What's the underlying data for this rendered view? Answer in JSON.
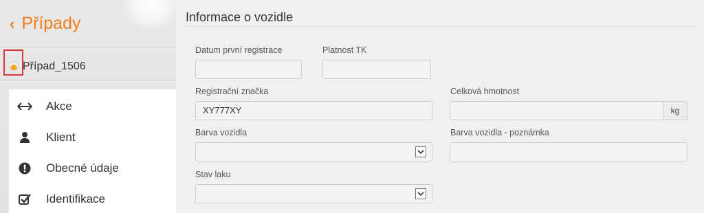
{
  "sidebar": {
    "back_label": "Případy",
    "case_label": "Případ_1506",
    "items": [
      {
        "label": "Akce",
        "icon": "double-arrow-icon"
      },
      {
        "label": "Klient",
        "icon": "user-icon"
      },
      {
        "label": "Obecné údaje",
        "icon": "exclamation-circle-icon"
      },
      {
        "label": "Identifikace",
        "icon": "checkbox-icon"
      }
    ]
  },
  "main": {
    "title": "Informace o vozidle",
    "fields": {
      "first_registration": {
        "label": "Datum první registrace",
        "value": ""
      },
      "tk_valid": {
        "label": "Platnost TK",
        "value": ""
      },
      "plate": {
        "label": "Registrační značka",
        "value": "XY777XY"
      },
      "weight": {
        "label": "Celková hmotnost",
        "value": "",
        "unit": "kg"
      },
      "color": {
        "label": "Barva vozidla",
        "value": ""
      },
      "color_note": {
        "label": "Barva vozidla - poznámka",
        "value": ""
      },
      "paint_state": {
        "label": "Stav laku",
        "value": ""
      }
    }
  },
  "colors": {
    "accent": "#f07c1c",
    "highlight_border": "#d63b3b"
  }
}
